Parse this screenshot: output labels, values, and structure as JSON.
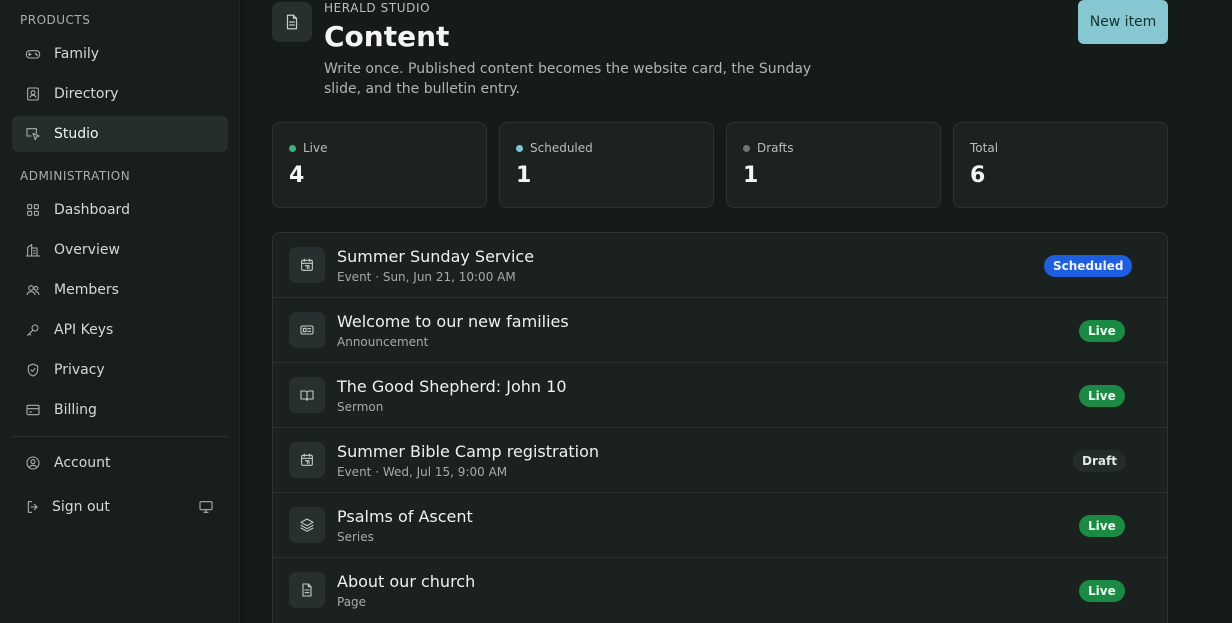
{
  "sidebar": {
    "products_label": "PRODUCTS",
    "admin_label": "ADMINISTRATION",
    "products": [
      {
        "label": "Family",
        "icon": "gamepad-icon"
      },
      {
        "label": "Directory",
        "icon": "contact-book-icon"
      },
      {
        "label": "Studio",
        "icon": "presentation-icon",
        "active": true
      }
    ],
    "admin": [
      {
        "label": "Dashboard",
        "icon": "grid-icon"
      },
      {
        "label": "Overview",
        "icon": "building-icon"
      },
      {
        "label": "Members",
        "icon": "users-icon"
      },
      {
        "label": "API Keys",
        "icon": "key-icon"
      },
      {
        "label": "Privacy",
        "icon": "shield-icon"
      },
      {
        "label": "Billing",
        "icon": "credit-card-icon"
      }
    ],
    "account": {
      "label": "Account",
      "icon": "user-circle-icon"
    },
    "signout": {
      "label": "Sign out",
      "icon": "logout-icon"
    }
  },
  "header": {
    "eyebrow": "HERALD STUDIO",
    "title": "Content",
    "description": "Write once. Published content becomes the website card, the Sunday slide, and the bulletin entry.",
    "new_button": "New item"
  },
  "stats": [
    {
      "label": "Live",
      "value": "4",
      "dot_color": "#3fb27f"
    },
    {
      "label": "Scheduled",
      "value": "1",
      "dot_color": "#7fc7d6"
    },
    {
      "label": "Drafts",
      "value": "1",
      "dot_color": "#6d7773"
    },
    {
      "label": "Total",
      "value": "6",
      "dot_color": ""
    }
  ],
  "items": [
    {
      "title": "Summer Sunday Service",
      "sub": "Event · Sun, Jun 21, 10:00 AM",
      "status": "Scheduled",
      "icon": "calendar-icon"
    },
    {
      "title": "Welcome to our new families",
      "sub": "Announcement",
      "status": "Live",
      "icon": "newspaper-icon"
    },
    {
      "title": "The Good Shepherd: John 10",
      "sub": "Sermon",
      "status": "Live",
      "icon": "book-open-icon"
    },
    {
      "title": "Summer Bible Camp registration",
      "sub": "Event · Wed, Jul 15, 9:00 AM",
      "status": "Draft",
      "icon": "calendar-icon"
    },
    {
      "title": "Psalms of Ascent",
      "sub": "Series",
      "status": "Live",
      "icon": "layers-icon"
    },
    {
      "title": "About our church",
      "sub": "Page",
      "status": "Live",
      "icon": "document-icon"
    }
  ],
  "colors": {
    "accent": "#86c7d2",
    "live": "#1b8a45",
    "scheduled": "#1e5fe0",
    "background": "#151b19"
  }
}
